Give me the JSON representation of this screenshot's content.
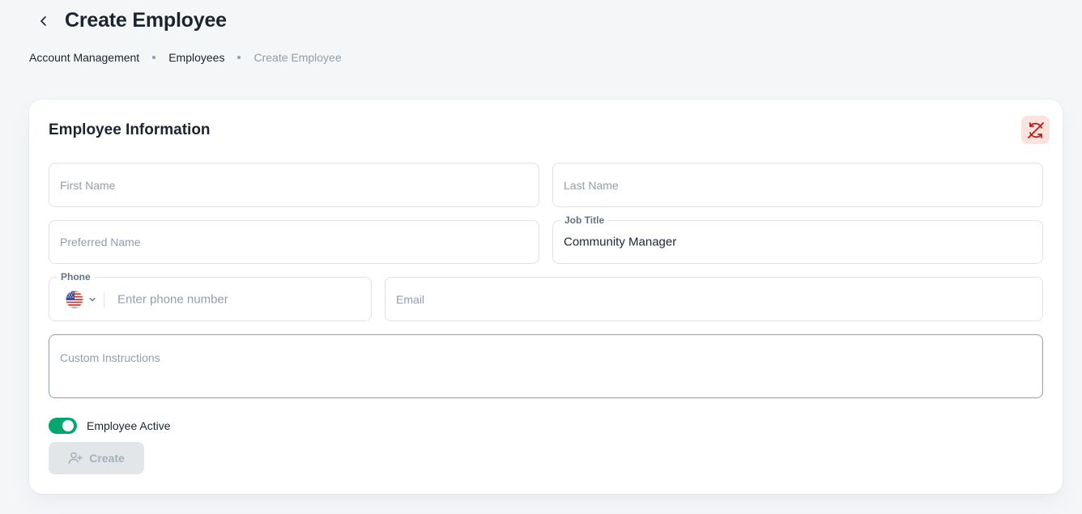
{
  "header": {
    "title": "Create Employee",
    "breadcrumb": [
      "Account Management",
      "Employees",
      "Create Employee"
    ]
  },
  "card": {
    "title": "Employee Information",
    "sync_icon": "sync-off-icon",
    "fields": {
      "first_name": {
        "placeholder": "First Name",
        "value": ""
      },
      "last_name": {
        "placeholder": "Last Name",
        "value": ""
      },
      "preferred_name": {
        "placeholder": "Preferred Name",
        "value": ""
      },
      "job_title": {
        "label": "Job Title",
        "value": "Community Manager"
      },
      "phone": {
        "label": "Phone",
        "country": "us-flag-icon",
        "placeholder": "Enter phone number"
      },
      "email": {
        "placeholder": "Email",
        "value": ""
      },
      "custom_instructions": {
        "placeholder": "Custom Instructions",
        "value": ""
      }
    },
    "toggle": {
      "label": "Employee Active",
      "on": true
    },
    "create_button": {
      "label": "Create",
      "icon": "user-add-icon"
    }
  },
  "colors": {
    "accent_green": "#00a76f",
    "sync_bg": "#fde3de",
    "sync_icon": "#b71d18",
    "text_primary": "#1c252e",
    "text_muted": "#919eab"
  }
}
